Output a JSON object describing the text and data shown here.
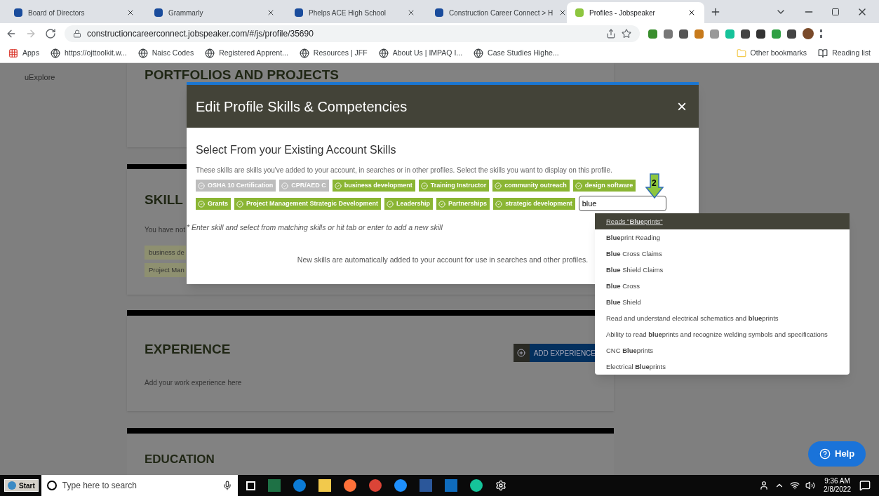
{
  "browser": {
    "tabs": [
      {
        "title": "Board of Directors",
        "selected": false
      },
      {
        "title": "Grammarly",
        "selected": false
      },
      {
        "title": "Phelps ACE High School",
        "selected": false
      },
      {
        "title": "Construction Career Connect > H",
        "selected": false
      },
      {
        "title": "Profiles - Jobspeaker",
        "selected": true
      }
    ],
    "url": "constructioncareerconnect.jobspeaker.com/#/js/profile/35690",
    "bookmarks": [
      "Apps",
      "https://ojttoolkit.w...",
      "Naisc Codes",
      "Registered Apprent...",
      "Resources | JFF",
      "About Us | IMPAQ I...",
      "Case Studies Highe..."
    ],
    "other_bookmarks": "Other bookmarks",
    "reading_list": "Reading list"
  },
  "sidebar": {
    "items": [
      "uExplore"
    ]
  },
  "page": {
    "portfolio_heading": "PORTFOLIOS AND PROJECTS",
    "skills": {
      "heading": "SKILL",
      "note": "You have not",
      "tags": [
        "business de",
        "Project Man"
      ]
    },
    "experience": {
      "heading": "EXPERIENCE",
      "button": "ADD EXPERIENCE",
      "hint": "Add your work experience here"
    },
    "education": {
      "heading": "EDUCATION"
    }
  },
  "modal": {
    "title": "Edit Profile Skills & Competencies",
    "close": "×",
    "subtitle": "Select From your Existing Account Skills",
    "description": "These skills are skills you've added to your account, in searches or in other profiles. Select the skills you want to display on this profile.",
    "skills": [
      {
        "label": "OSHA 10 Certification",
        "selected": false
      },
      {
        "label": "CPR/AED C",
        "selected": false
      },
      {
        "label": "business development",
        "selected": true
      },
      {
        "label": "Training Instructor",
        "selected": true
      },
      {
        "label": "community outreach",
        "selected": true
      },
      {
        "label": "design software",
        "selected": true
      },
      {
        "label": "Grants",
        "selected": true
      },
      {
        "label": "Project Management Strategic Development",
        "selected": true
      },
      {
        "label": "Leadership",
        "selected": true
      },
      {
        "label": "Partnerships",
        "selected": true
      },
      {
        "label": "strategic development",
        "selected": true
      }
    ],
    "input": {
      "value": "blue"
    },
    "hint": "* Enter skill and select from matching skills or hit tab or enter to add a new skill",
    "footer": "New skills are automatically added to your account for use in searches and other profiles."
  },
  "suggestions": [
    {
      "text": "Reads \"**Blue**prints\"",
      "selected": true
    },
    {
      "text": "**Blue**print Reading",
      "selected": false
    },
    {
      "text": "**Blue** Cross Claims",
      "selected": false
    },
    {
      "text": "**Blue** Shield Claims",
      "selected": false
    },
    {
      "text": "**Blue** Cross",
      "selected": false
    },
    {
      "text": "**Blue** Shield",
      "selected": false
    },
    {
      "text": "Read and understand electrical schematics and **blue**prints",
      "selected": false
    },
    {
      "text": "Ability to read **blue**prints and recognize welding symbols and specifications",
      "selected": false
    },
    {
      "text": "CNC **Blue**prints",
      "selected": false
    },
    {
      "text": "Electrical **Blue**prints",
      "selected": false
    }
  ],
  "callout": {
    "number": "2"
  },
  "help_button": "Help",
  "taskbar": {
    "start": "Start",
    "search_placeholder": "Type here to search",
    "time": "9:36 AM",
    "date": "2/8/2022"
  }
}
